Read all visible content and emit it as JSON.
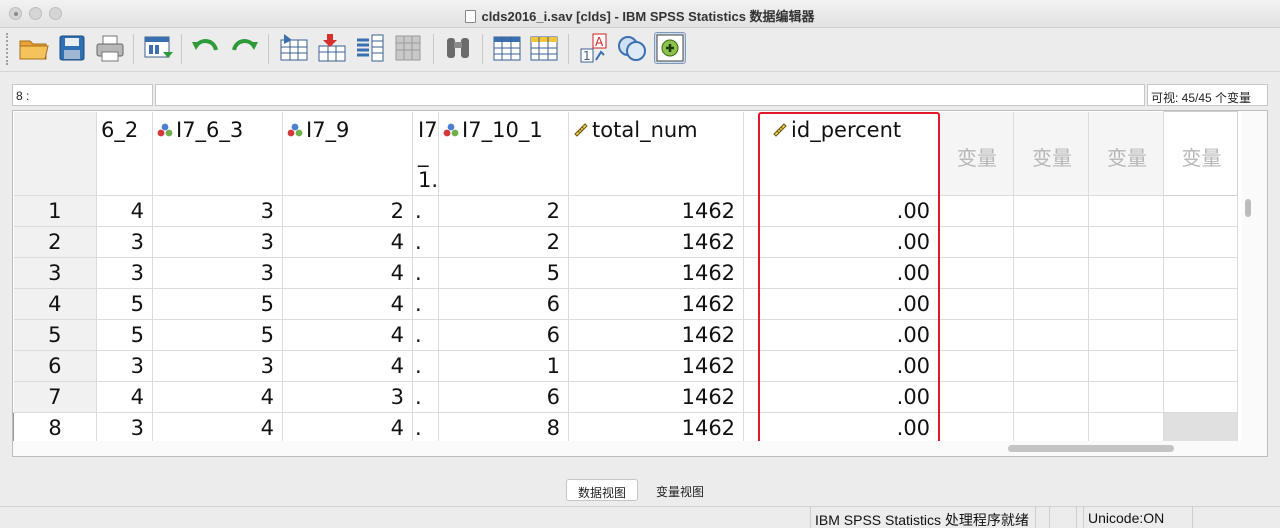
{
  "window": {
    "title": "clds2016_i.sav [clds] - IBM SPSS Statistics 数据编辑器"
  },
  "toolbar": {
    "buttons": [
      {
        "icon": "open-folder-icon"
      },
      {
        "icon": "save-icon"
      },
      {
        "icon": "print-icon"
      },
      {
        "icon": "recall-dialog-icon"
      },
      {
        "icon": "undo-icon"
      },
      {
        "icon": "redo-icon"
      },
      {
        "icon": "goto-case-icon"
      },
      {
        "icon": "goto-variable-icon"
      },
      {
        "icon": "variables-icon"
      },
      {
        "icon": "run-descriptives-icon"
      },
      {
        "icon": "find-icon"
      },
      {
        "icon": "insert-cases-icon"
      },
      {
        "icon": "insert-variable-icon"
      },
      {
        "icon": "split-file-icon"
      },
      {
        "icon": "weight-cases-icon"
      },
      {
        "icon": "select-cases-icon"
      },
      {
        "icon": "value-labels-icon"
      }
    ]
  },
  "cell_editor": {
    "cell_ref": "8 :",
    "value": "",
    "visible_count": "可视: 45/45 个变量"
  },
  "grid": {
    "columns": [
      {
        "name": "6_2",
        "type": ""
      },
      {
        "name": "I7_6_3",
        "type": "nominal"
      },
      {
        "name": "I7_9",
        "type": "nominal"
      },
      {
        "name": "I7_1.",
        "type": ""
      },
      {
        "name": "I7_10_1",
        "type": "nominal"
      },
      {
        "name": "total_num",
        "type": "scale"
      },
      {
        "name": "id_percent",
        "type": "scale"
      }
    ],
    "narrow_header_lines": [
      "I7",
      "_",
      "1."
    ],
    "empty_column_label": "变量",
    "rows": [
      {
        "n": "1",
        "cells": [
          "4",
          "3",
          "2",
          ".",
          "2",
          "1462",
          ".00"
        ]
      },
      {
        "n": "2",
        "cells": [
          "3",
          "3",
          "4",
          ".",
          "2",
          "1462",
          ".00"
        ]
      },
      {
        "n": "3",
        "cells": [
          "3",
          "3",
          "4",
          ".",
          "5",
          "1462",
          ".00"
        ]
      },
      {
        "n": "4",
        "cells": [
          "5",
          "5",
          "4",
          ".",
          "6",
          "1462",
          ".00"
        ]
      },
      {
        "n": "5",
        "cells": [
          "5",
          "5",
          "4",
          ".",
          "6",
          "1462",
          ".00"
        ]
      },
      {
        "n": "6",
        "cells": [
          "3",
          "3",
          "4",
          ".",
          "1",
          "1462",
          ".00"
        ]
      },
      {
        "n": "7",
        "cells": [
          "4",
          "4",
          "3",
          ".",
          "6",
          "1462",
          ".00"
        ]
      },
      {
        "n": "8",
        "cells": [
          "3",
          "4",
          "4",
          ".",
          "8",
          "1462",
          ".00"
        ]
      }
    ],
    "highlighted_column": "id_percent",
    "highlight_color": "#e0192a"
  },
  "tabs": {
    "data_view": "数据视图",
    "variable_view": "变量视图",
    "active": "data_view"
  },
  "status": {
    "processor": "IBM SPSS Statistics 处理程序就绪",
    "unicode": "Unicode:ON"
  }
}
